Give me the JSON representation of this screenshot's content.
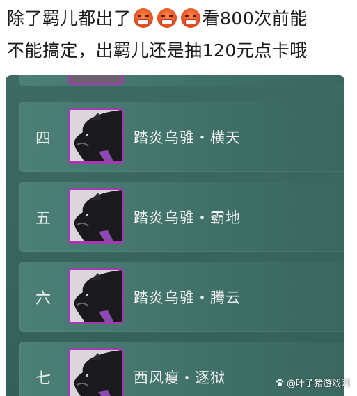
{
  "caption": {
    "line1_a": "除了羁儿都出了",
    "line1_b": "看800次前能",
    "line2": "不能搞定，出羁儿还是抽120元点卡哦",
    "emoji_icon": "angry-grimace-emoji",
    "emoji_count": 3
  },
  "rows": [
    {
      "number": "四",
      "name": "踏炎乌骓・横天"
    },
    {
      "number": "五",
      "name": "踏炎乌骓・霸地"
    },
    {
      "number": "六",
      "name": "踏炎乌骓・腾云"
    },
    {
      "number": "七",
      "name": "西风瘦・逐狱"
    }
  ],
  "watermark": "@叶子猪游戏网",
  "colors": {
    "panel": "#3d6a63",
    "row": "#4c8077",
    "thumb_border": "#a23bb0",
    "emoji": "#e0461a"
  }
}
